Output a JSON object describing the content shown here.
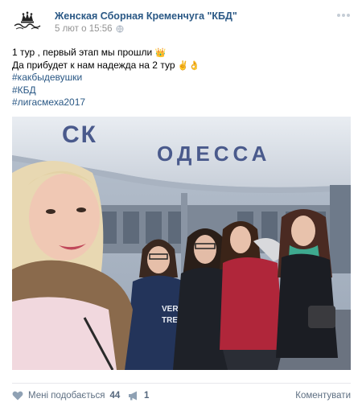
{
  "post": {
    "author": "Женская Сборная Кременчуга \"КБД\"",
    "date": "5 лют о 15:56",
    "text_lines": [
      "1 тур , первый этап мы прошли",
      "Да прибудет к нам надежда на 2 тур"
    ],
    "hashtags": [
      "#какбыдевушки",
      "#КБД",
      "#лигасмеха2017"
    ],
    "photo_sign_text": "СК ОДЕССА",
    "jacket_text": "VERY TREND"
  },
  "footer": {
    "like_label": "Мені подобається",
    "like_count": "44",
    "share_count": "1",
    "comments_label": "Коментувати"
  },
  "colors": {
    "link": "#2a5885",
    "meta": "#939393",
    "footer": "#5e6f82"
  },
  "icons": [
    "crown-logo-icon",
    "globe-icon",
    "more-dots-icon",
    "heart-icon",
    "megaphone-icon"
  ]
}
